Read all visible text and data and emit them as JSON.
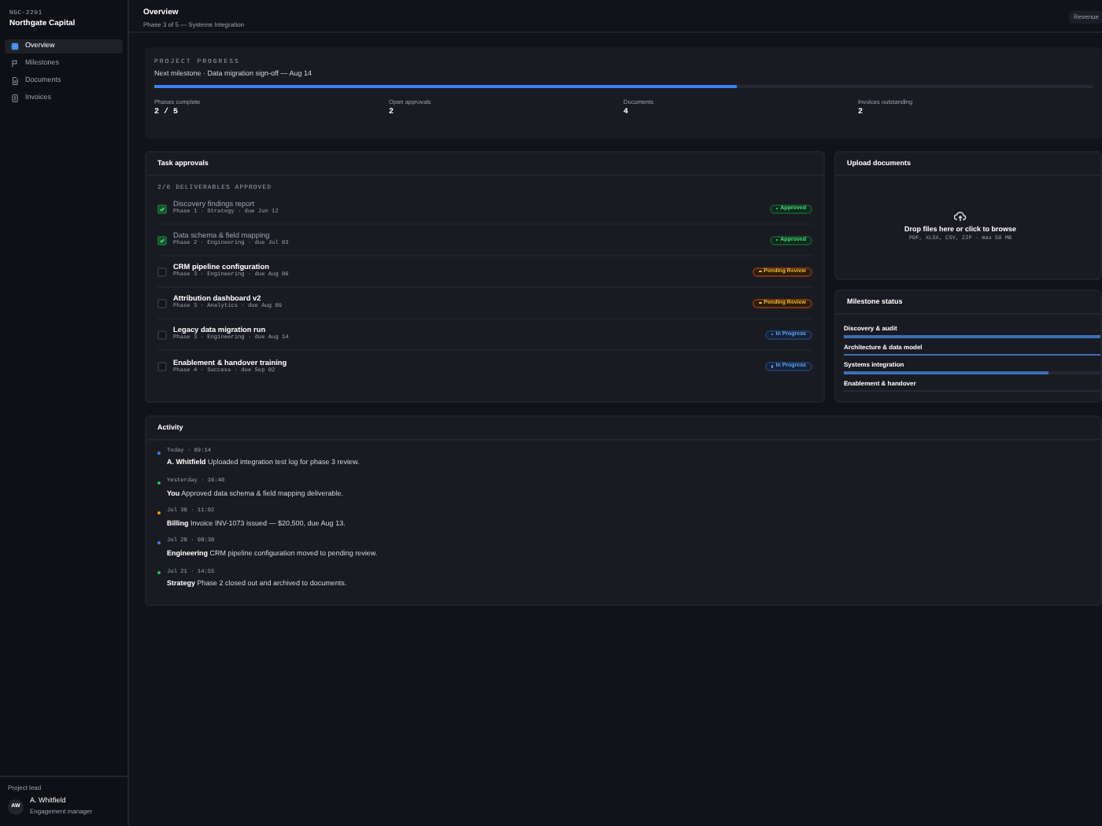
{
  "sidebar": {
    "code": "NGC-2291",
    "client": "Northgate Capital",
    "items": [
      {
        "label": "Overview",
        "selected": true
      },
      {
        "label": "Milestones",
        "selected": false
      },
      {
        "label": "Documents",
        "selected": false
      },
      {
        "label": "Invoices",
        "selected": false
      }
    ],
    "lead": {
      "heading": "Project lead",
      "initials": "AW",
      "name": "A. Whitfield",
      "role": "Engagement manager"
    }
  },
  "header": {
    "title": "Overview",
    "subtitle": "Phase 3 of 5 — Systems Integration",
    "button": "Revenue"
  },
  "progress": {
    "heading": "PROJECT PROGRESS",
    "next": "Next milestone · Data migration sign-off — Aug 14",
    "level": 0.62,
    "stats": [
      {
        "label": "Phases complete",
        "value": "2 / 5"
      },
      {
        "label": "Open approvals",
        "value": "2"
      },
      {
        "label": "Documents",
        "value": "4"
      },
      {
        "label": "Invoices outstanding",
        "value": "2"
      }
    ]
  },
  "tasks": {
    "title": "Task approvals",
    "summary": "2/6 DELIVERABLES APPROVED",
    "items": [
      {
        "name": "Discovery findings report",
        "meta": "Phase 1 · Strategy · due Jun 12",
        "checked": true,
        "status": "Approved",
        "kind": "approved"
      },
      {
        "name": "Data schema & field mapping",
        "meta": "Phase 2 · Engineering · due Jul 03",
        "checked": true,
        "status": "Approved",
        "kind": "approved"
      },
      {
        "name": "CRM pipeline configuration",
        "meta": "Phase 3 · Engineering · due Aug 06",
        "checked": false,
        "status": "Pending Review",
        "kind": "pending"
      },
      {
        "name": "Attribution dashboard v2",
        "meta": "Phase 3 · Analytics · due Aug 09",
        "checked": false,
        "status": "Pending Review",
        "kind": "pending"
      },
      {
        "name": "Legacy data migration run",
        "meta": "Phase 3 · Engineering · due Aug 14",
        "checked": false,
        "status": "In Progress",
        "kind": "progress"
      },
      {
        "name": "Enablement & handover training",
        "meta": "Phase 4 · Success · due Sep 02",
        "checked": false,
        "status": "In Progress",
        "kind": "progress"
      }
    ]
  },
  "upload": {
    "title": "Upload documents",
    "prompt": "Drop files here or click to browse",
    "hint": "PDF, XLSX, CSV, ZIP · max 50 MB"
  },
  "milestones": {
    "title": "Milestone status",
    "items": [
      {
        "label": "Discovery & audit",
        "level": 1
      },
      {
        "label": "Architecture & data model",
        "level": 1
      },
      {
        "label": "Systems integration",
        "level": 0.8
      },
      {
        "label": "Enablement & handover",
        "level": 0
      }
    ]
  },
  "activity": {
    "title": "Activity",
    "items": [
      {
        "time": "Today · 09:14",
        "actor": "A. Whitfield",
        "text": "Uploaded integration test log for phase 3 review.",
        "color": "#3b82f6"
      },
      {
        "time": "Yesterday · 16:40",
        "actor": "You",
        "text": "Approved data schema & field mapping deliverable.",
        "color": "#22c55e"
      },
      {
        "time": "Jul 30 · 11:02",
        "actor": "Billing",
        "text": "Invoice INV-1073 issued — $20,500, due Aug 13.",
        "color": "#f59e0b"
      },
      {
        "time": "Jul 28 · 08:30",
        "actor": "Engineering",
        "text": "CRM pipeline configuration moved to pending review.",
        "color": "#3b82f6"
      },
      {
        "time": "Jul 21 · 14:55",
        "actor": "Strategy",
        "text": "Phase 2 closed out and archived to documents.",
        "color": "#22c55e"
      }
    ]
  }
}
